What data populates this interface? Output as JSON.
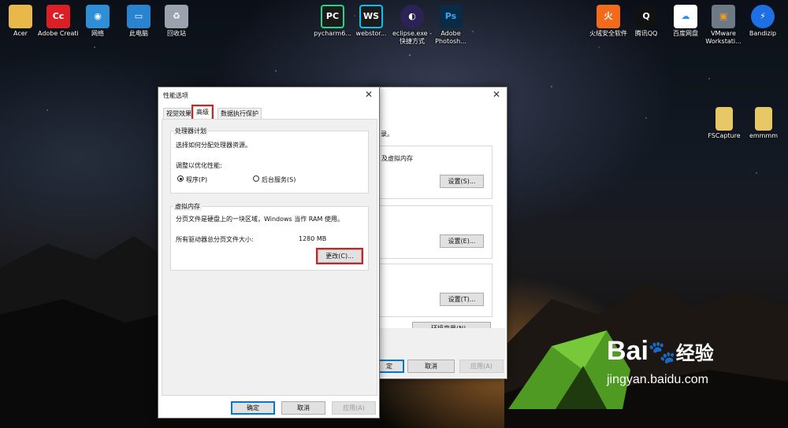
{
  "desktop_icons": [
    {
      "label": "Acer",
      "icon": "folder-user-icon",
      "color": "#e8b84a",
      "glyph": ""
    },
    {
      "label": "Adobe Creati...",
      "icon": "adobe-cc-icon",
      "color": "#da1f26",
      "glyph": "Cc"
    },
    {
      "label": "网络",
      "icon": "network-icon",
      "color": "#2f8fd6",
      "glyph": "◉"
    },
    {
      "label": "此电脑",
      "icon": "computer-icon",
      "color": "#2a83cf",
      "glyph": "▭"
    },
    {
      "label": "回收站",
      "icon": "recycle-bin-icon",
      "color": "#9aa3ad",
      "glyph": "♻"
    },
    {
      "label": "pycharm6...",
      "icon": "pycharm-icon",
      "color": "#1b1b1b",
      "glyph": "PC"
    },
    {
      "label": "webstor...",
      "icon": "webstorm-icon",
      "color": "#1b1b1b",
      "glyph": "WS"
    },
    {
      "label": "eclipse.exe - 快捷方式",
      "icon": "eclipse-icon",
      "color": "#2c2255",
      "glyph": "◐"
    },
    {
      "label": "Adobe Photosh...",
      "icon": "photoshop-icon",
      "color": "#0b2b45",
      "glyph": "Ps"
    },
    {
      "label": "火绒安全软件",
      "icon": "huorong-icon",
      "color": "#f26a1b",
      "glyph": "火"
    },
    {
      "label": "腾讯QQ",
      "icon": "qq-icon",
      "color": "#111111",
      "glyph": "Q"
    },
    {
      "label": "百度网盘",
      "icon": "baidu-netdisk-icon",
      "color": "#ffffff",
      "glyph": "☁"
    },
    {
      "label": "VMware Workstati...",
      "icon": "vmware-icon",
      "color": "#6d7a86",
      "glyph": "▣"
    },
    {
      "label": "Bandizip",
      "icon": "bandizip-icon",
      "color": "#1d6fe3",
      "glyph": "⚡"
    },
    {
      "label": "FSCapture",
      "icon": "zip-folder-icon",
      "color": "#e8c766",
      "glyph": ""
    },
    {
      "label": "emmmm",
      "icon": "zip-folder-icon",
      "color": "#e8c766",
      "glyph": ""
    }
  ],
  "back_window": {
    "title": "",
    "intro": "录。",
    "group1_text": "及虚拟内存",
    "settings_s": "设置(S)...",
    "settings_e": "设置(E)...",
    "settings_t": "设置(T)...",
    "env_vars": "环境变量(N)...",
    "ok": "定",
    "cancel": "取消",
    "apply": "应用(A)"
  },
  "perf_dialog": {
    "title": "性能选项",
    "tabs": [
      "视觉效果",
      "高级",
      "数据执行保护"
    ],
    "processor": {
      "title": "处理器计划",
      "desc": "选择如何分配处理器资源。",
      "adjust_label": "调整以优化性能:",
      "opt_programs": "程序(P)",
      "opt_services": "后台服务(S)",
      "selected": "程序(P)"
    },
    "vm": {
      "title": "虚拟内存",
      "desc": "分页文件是硬盘上的一块区域，Windows 当作 RAM 使用。",
      "total_label": "所有驱动器总分页文件大小:",
      "total_value": "1280 MB",
      "change": "更改(C)..."
    },
    "ok": "确定",
    "cancel": "取消",
    "apply": "应用(A)"
  },
  "watermark": {
    "brand": "Bai",
    "paw": "du",
    "cn": "经验",
    "url": "jingyan.baidu.com"
  }
}
